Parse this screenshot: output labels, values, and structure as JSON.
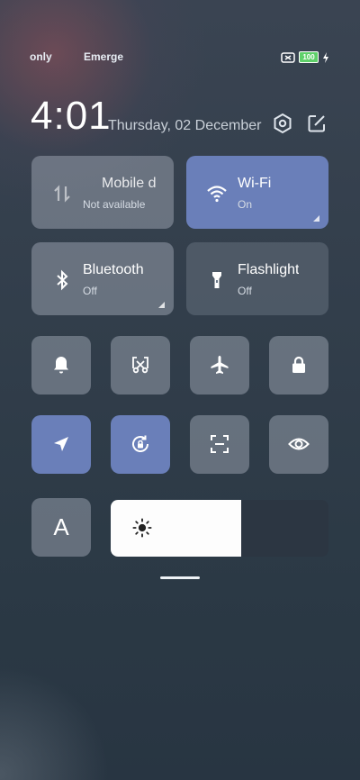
{
  "status": {
    "carrier_left": "only",
    "carrier_right": "Emerge",
    "battery_level": "100"
  },
  "header": {
    "time": "4:01",
    "date": "Thursday, 02 December"
  },
  "tiles_big": [
    {
      "title": "Mobile d",
      "subtitle": "Not available"
    },
    {
      "title": "Wi-Fi",
      "subtitle": "On"
    },
    {
      "title": "Bluetooth",
      "subtitle": "Off"
    },
    {
      "title": "Flashlight",
      "subtitle": "Off"
    }
  ],
  "font_tile": {
    "letter": "A"
  },
  "brightness": {
    "level": 0.6
  },
  "colors": {
    "accent": "#6a7fb9",
    "battery": "#5fd06a"
  }
}
